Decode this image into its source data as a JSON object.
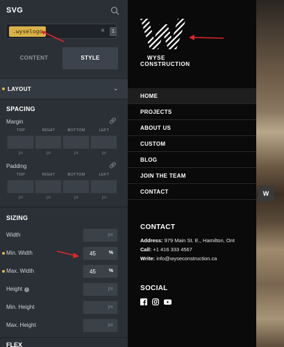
{
  "panel": {
    "title": "SVG",
    "selector": {
      "chip": ".wyselogo",
      "close": "×",
      "count": "1"
    },
    "tabs": {
      "content": "CONTENT",
      "style": "STYLE"
    },
    "layout_label": "LAYOUT",
    "spacing": {
      "heading": "SPACING",
      "margin_label": "Margin",
      "padding_label": "Padding",
      "sides": [
        "TOP",
        "RIGHT",
        "BOTTOM",
        "LEFT"
      ],
      "unit": "px"
    },
    "sizing": {
      "heading": "SIZING",
      "rows": [
        {
          "label": "Width",
          "value": "",
          "unit": "px",
          "active": false
        },
        {
          "label": "Min. Width",
          "value": "45",
          "unit": "%",
          "active": true
        },
        {
          "label": "Max. Width",
          "value": "45",
          "unit": "%",
          "active": true
        },
        {
          "label": "Height",
          "value": "",
          "unit": "px",
          "active": false,
          "info": true
        },
        {
          "label": "Min. Height",
          "value": "",
          "unit": "px",
          "active": false
        },
        {
          "label": "Max. Height",
          "value": "",
          "unit": "px",
          "active": false
        }
      ]
    },
    "flex_heading": "FLEX"
  },
  "site": {
    "logo_line1": "WYSE",
    "logo_line2": "CONSTRUCTION",
    "nav": [
      "HOME",
      "PROJECTS",
      "ABOUT US",
      "CUSTOM",
      "BLOG",
      "JOIN THE TEAM",
      "CONTACT"
    ],
    "contact": {
      "heading": "CONTACT",
      "address_label": "Address:",
      "address": "979 Main St. E., Hamilton, Ont",
      "call_label": "Call:",
      "call": "+1 416 333 4567",
      "write_label": "Write:",
      "write": "info@wyseconstruction.ca"
    },
    "social_heading": "SOCIAL",
    "social_icons": [
      "facebook-icon",
      "instagram-icon",
      "youtube-icon"
    ]
  },
  "photo_badge": "W",
  "colors": {
    "panel_bg": "#2b3036",
    "accent": "#d9b24a",
    "site_bg": "#0a0a0a",
    "annotation_arrow": "#e0262b"
  }
}
